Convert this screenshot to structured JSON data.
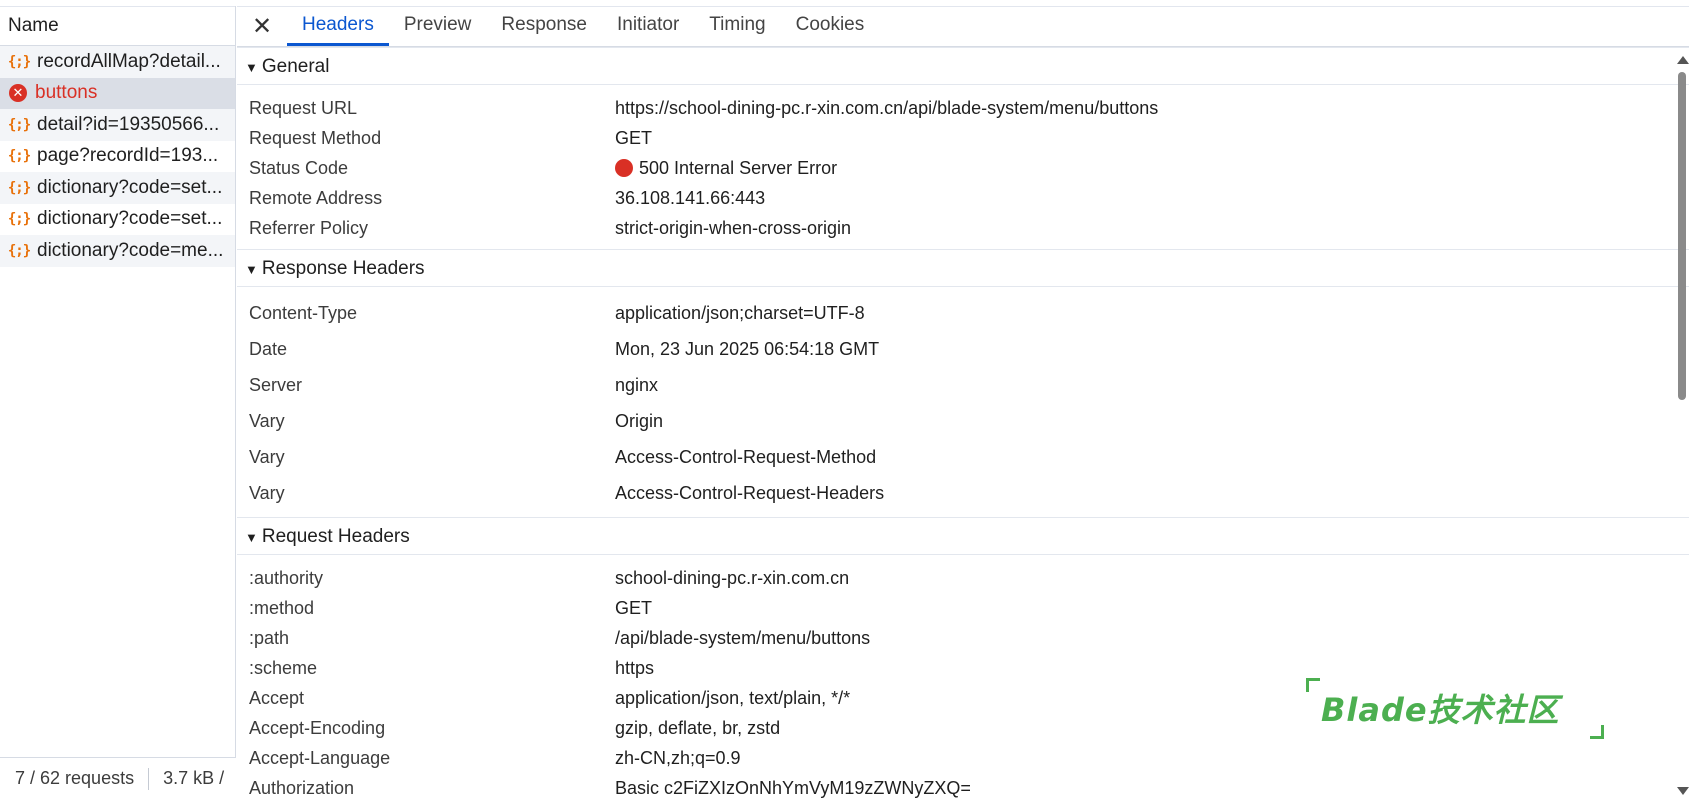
{
  "left": {
    "name_header": "Name",
    "requests": [
      {
        "label": "recordAllMap?detail...",
        "icon": "json-icon",
        "state": "normal"
      },
      {
        "label": "buttons",
        "icon": "error-icon",
        "state": "error"
      },
      {
        "label": "detail?id=19350566...",
        "icon": "json-icon",
        "state": "normal"
      },
      {
        "label": "page?recordId=193...",
        "icon": "json-icon",
        "state": "normal"
      },
      {
        "label": "dictionary?code=set...",
        "icon": "json-icon",
        "state": "normal"
      },
      {
        "label": "dictionary?code=set...",
        "icon": "json-icon",
        "state": "normal"
      },
      {
        "label": "dictionary?code=me...",
        "icon": "json-icon",
        "state": "normal"
      }
    ],
    "summary": {
      "requests": "7 / 62 requests",
      "size": "3.7 kB /"
    }
  },
  "tabs": {
    "close": "✕",
    "items": [
      "Headers",
      "Preview",
      "Response",
      "Initiator",
      "Timing",
      "Cookies"
    ],
    "active": "Headers"
  },
  "general": {
    "title": "General",
    "rows": [
      {
        "key": "Request URL",
        "value": "https://school-dining-pc.r-xin.com.cn/api/blade-system/menu/buttons"
      },
      {
        "key": "Request Method",
        "value": "GET"
      },
      {
        "key": "Status Code",
        "value": "500 Internal Server Error"
      },
      {
        "key": "Remote Address",
        "value": "36.108.141.66:443"
      },
      {
        "key": "Referrer Policy",
        "value": "strict-origin-when-cross-origin"
      }
    ]
  },
  "response_headers": {
    "title": "Response Headers",
    "rows": [
      {
        "key": "Content-Type",
        "value": "application/json;charset=UTF-8"
      },
      {
        "key": "Date",
        "value": "Mon, 23 Jun 2025 06:54:18 GMT"
      },
      {
        "key": "Server",
        "value": "nginx"
      },
      {
        "key": "Vary",
        "value": "Origin"
      },
      {
        "key": "Vary",
        "value": "Access-Control-Request-Method"
      },
      {
        "key": "Vary",
        "value": "Access-Control-Request-Headers"
      }
    ]
  },
  "request_headers": {
    "title": "Request Headers",
    "rows": [
      {
        "key": ":authority",
        "value": "school-dining-pc.r-xin.com.cn"
      },
      {
        "key": ":method",
        "value": "GET"
      },
      {
        "key": ":path",
        "value": "/api/blade-system/menu/buttons"
      },
      {
        "key": ":scheme",
        "value": "https"
      },
      {
        "key": "Accept",
        "value": "application/json, text/plain, */*"
      },
      {
        "key": "Accept-Encoding",
        "value": "gzip, deflate, br, zstd"
      },
      {
        "key": "Accept-Language",
        "value": "zh-CN,zh;q=0.9"
      },
      {
        "key": "Authorization",
        "value": "Basic c2FiZXIzOnNhYmVyM19zZWNyZXQ="
      }
    ]
  },
  "watermark": "Blade技术社区",
  "colors": {
    "accent": "#0b57d0",
    "error": "#d93025",
    "json_icon": "#e8710a",
    "watermark": "#4caf50"
  }
}
